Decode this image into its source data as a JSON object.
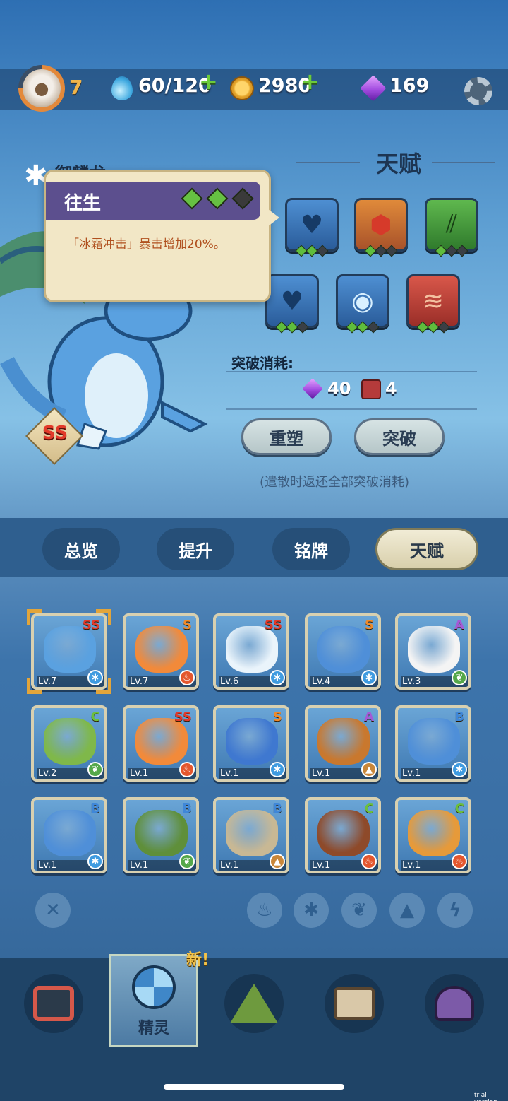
{
  "status": {
    "player_level": "7",
    "stamina": "60/120",
    "coins": "2980",
    "gems": "169"
  },
  "monster": {
    "name": "御麟龙",
    "rank": "SS"
  },
  "talent": {
    "title": "天赋",
    "tooltip_title": "往生",
    "tooltip_text": "「冰霜冲击」暴击增加20%。",
    "tooltip_level": "2/3"
  },
  "breakthrough": {
    "label": "突破消耗:",
    "gem_cost": "40",
    "item_cost": "4",
    "reshape_button": "重塑",
    "breakthrough_button": "突破",
    "refund_note": "(遣散时返还全部突破消耗)"
  },
  "tabs": [
    "总览",
    "提升",
    "铭牌",
    "天赋"
  ],
  "monsters": [
    {
      "rank": "SS",
      "level": "Lv.7",
      "element": "ice"
    },
    {
      "rank": "S",
      "level": "Lv.7",
      "element": "fire"
    },
    {
      "rank": "SS",
      "level": "Lv.6",
      "element": "ice"
    },
    {
      "rank": "S",
      "level": "Lv.4",
      "element": "ice"
    },
    {
      "rank": "A",
      "level": "Lv.3",
      "element": "leaf"
    },
    {
      "rank": "C",
      "level": "Lv.2",
      "element": "leaf"
    },
    {
      "rank": "SS",
      "level": "Lv.1",
      "element": "fire"
    },
    {
      "rank": "S",
      "level": "Lv.1",
      "element": "ice"
    },
    {
      "rank": "A",
      "level": "Lv.1",
      "element": "earth"
    },
    {
      "rank": "B",
      "level": "Lv.1",
      "element": "ice"
    },
    {
      "rank": "B",
      "level": "Lv.1",
      "element": "ice"
    },
    {
      "rank": "B",
      "level": "Lv.1",
      "element": "leaf"
    },
    {
      "rank": "B",
      "level": "Lv.1",
      "element": "earth"
    },
    {
      "rank": "C",
      "level": "Lv.1",
      "element": "fire"
    },
    {
      "rank": "C",
      "level": "Lv.1",
      "element": "fire"
    }
  ],
  "filters": [
    "clear-filter-icon",
    "fire-icon",
    "ice-icon",
    "leaf-icon",
    "earth-icon",
    "lightning-icon"
  ],
  "nav": {
    "active_label": "精灵",
    "new_badge": "新!"
  },
  "watermark": "trial version",
  "colors": {
    "accent_orange": "#e3a53a",
    "element_fire": "#e4572e",
    "element_ice": "#3f9be0",
    "element_leaf": "#55a84a",
    "element_earth": "#c9873a"
  }
}
